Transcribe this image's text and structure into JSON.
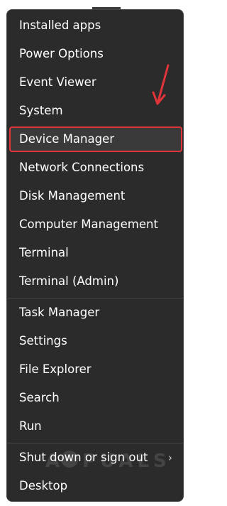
{
  "menu": {
    "items": [
      {
        "id": "installed-apps",
        "label": "Installed apps"
      },
      {
        "id": "power-options",
        "label": "Power Options"
      },
      {
        "id": "event-viewer",
        "label": "Event Viewer"
      },
      {
        "id": "system",
        "label": "System"
      },
      {
        "id": "device-manager",
        "label": "Device Manager",
        "highlighted": true
      },
      {
        "id": "network-connections",
        "label": "Network Connections"
      },
      {
        "id": "disk-management",
        "label": "Disk Management"
      },
      {
        "id": "computer-management",
        "label": "Computer Management"
      },
      {
        "id": "terminal",
        "label": "Terminal"
      },
      {
        "id": "terminal-admin",
        "label": "Terminal (Admin)"
      },
      {
        "id": "task-manager",
        "label": "Task Manager"
      },
      {
        "id": "settings",
        "label": "Settings"
      },
      {
        "id": "file-explorer",
        "label": "File Explorer"
      },
      {
        "id": "search",
        "label": "Search"
      },
      {
        "id": "run",
        "label": "Run"
      },
      {
        "id": "shut-down",
        "label": "Shut down or sign out",
        "submenu_icon": "chevron-right-icon"
      },
      {
        "id": "desktop",
        "label": "Desktop"
      }
    ]
  },
  "annotation": {
    "color": "#e0343a",
    "icon": "red-arrow-icon"
  },
  "watermark": {
    "text": "APPUALS",
    "icon": "appuals-logo-icon"
  }
}
